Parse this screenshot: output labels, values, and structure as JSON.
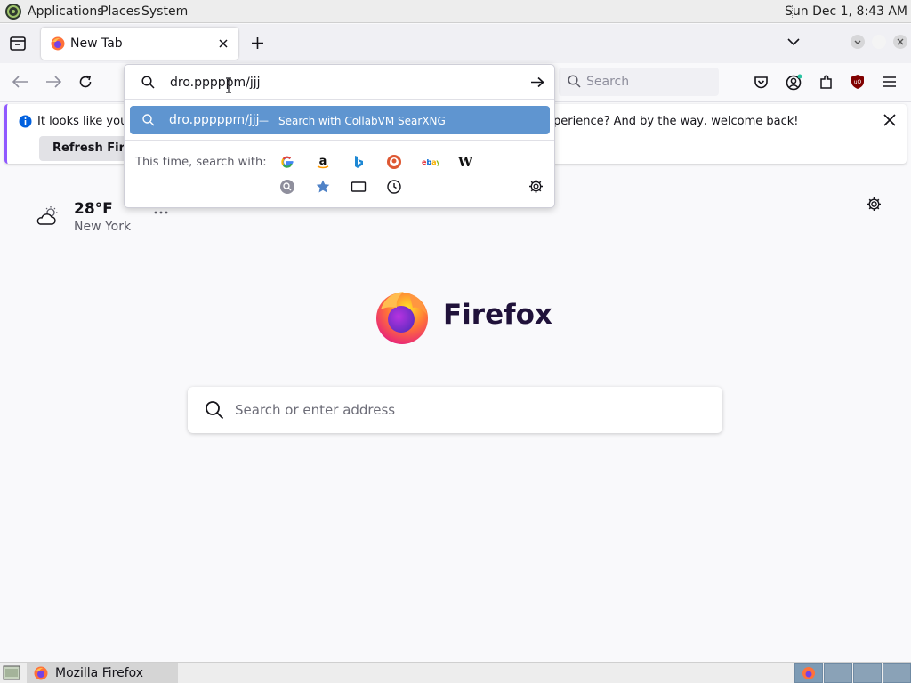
{
  "panel": {
    "menus": [
      "Applications",
      "Places",
      "System"
    ],
    "clock": "Sun Dec 1,  8:43 AM"
  },
  "tabs": [
    {
      "title": "New Tab",
      "icon": "firefox-icon"
    }
  ],
  "navbar": {
    "search_placeholder": "Search"
  },
  "urlbar": {
    "value": "dro.pppppm/jjj",
    "suggestion": {
      "text": "dro.pppppm/jjj",
      "separator": "—",
      "action": "Search with CollabVM SearXNG"
    },
    "one_off_label": "This time, search with:",
    "engines": [
      "google-icon",
      "amazon-icon",
      "bing-icon",
      "duckduckgo-icon",
      "ebay-icon",
      "wikipedia-icon"
    ],
    "modes": [
      "search-engine-icon",
      "bookmark-star-icon",
      "tabs-icon",
      "history-clock-icon"
    ]
  },
  "notification": {
    "message_start": "It looks like you h",
    "message_end": "perience? And by the way, welcome back!",
    "button_label": "Refresh Firefox"
  },
  "weather": {
    "temperature": "28°F",
    "location": "New York"
  },
  "newtab": {
    "brand": "Firefox",
    "search_placeholder": "Search or enter address"
  },
  "taskbar": {
    "window_label": "Mozilla Firefox"
  },
  "colors": {
    "accent": "#5f95d0",
    "notification_border": "#9059ff",
    "ublock": "#800000"
  }
}
